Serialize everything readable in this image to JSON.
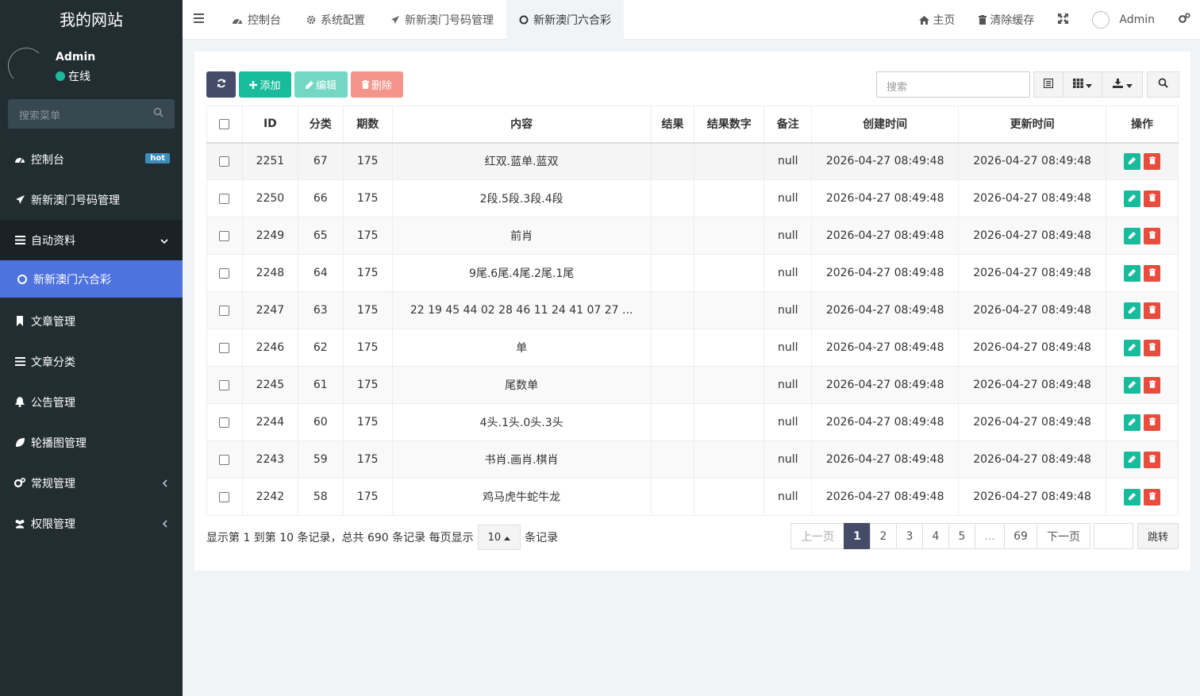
{
  "sidebar": {
    "brand": "我的网站",
    "user": {
      "name": "Admin",
      "status": "在线"
    },
    "search_placeholder": "搜索菜单",
    "menu": [
      {
        "label": "控制台",
        "icon": "dashboard-icon",
        "badge": "hot"
      },
      {
        "label": "新新澳门号码管理",
        "icon": "paper-plane-icon"
      },
      {
        "label": "自动资料",
        "icon": "list-icon",
        "expanded": true
      },
      {
        "label": "新新澳门六合彩",
        "icon": "circle-icon",
        "active": true
      },
      {
        "label": "文章管理",
        "icon": "bookmark-icon"
      },
      {
        "label": "文章分类",
        "icon": "list-icon"
      },
      {
        "label": "公告管理",
        "icon": "bell-icon"
      },
      {
        "label": "轮播图管理",
        "icon": "leaf-icon"
      },
      {
        "label": "常规管理",
        "icon": "cogs-icon"
      },
      {
        "label": "权限管理",
        "icon": "users-icon"
      }
    ]
  },
  "topbar": {
    "tabs": [
      {
        "label": "控制台",
        "icon": "dashboard-icon"
      },
      {
        "label": "系统配置",
        "icon": "gear-icon"
      },
      {
        "label": "新新澳门号码管理",
        "icon": "paper-plane-icon"
      },
      {
        "label": "新新澳门六合彩",
        "icon": "circle-icon",
        "active": true
      }
    ],
    "home_label": "主页",
    "clear_cache_label": "清除缓存",
    "user_name": "Admin"
  },
  "toolbar": {
    "add_label": "添加",
    "edit_label": "编辑",
    "delete_label": "删除",
    "search_placeholder": "搜索"
  },
  "table": {
    "columns": [
      "ID",
      "分类",
      "期数",
      "内容",
      "结果",
      "结果数字",
      "备注",
      "创建时间",
      "更新时间",
      "操作"
    ],
    "rows": [
      {
        "id": "2251",
        "cat": "67",
        "period": "175",
        "content": "红双.蓝单.蓝双",
        "result": "",
        "result_num": "",
        "note": "null",
        "created": "2026-04-27 08:49:48",
        "updated": "2026-04-27 08:49:48"
      },
      {
        "id": "2250",
        "cat": "66",
        "period": "175",
        "content": "2段.5段.3段.4段",
        "result": "",
        "result_num": "",
        "note": "null",
        "created": "2026-04-27 08:49:48",
        "updated": "2026-04-27 08:49:48"
      },
      {
        "id": "2249",
        "cat": "65",
        "period": "175",
        "content": "前肖",
        "result": "",
        "result_num": "",
        "note": "null",
        "created": "2026-04-27 08:49:48",
        "updated": "2026-04-27 08:49:48"
      },
      {
        "id": "2248",
        "cat": "64",
        "period": "175",
        "content": "9尾.6尾.4尾.2尾.1尾",
        "result": "",
        "result_num": "",
        "note": "null",
        "created": "2026-04-27 08:49:48",
        "updated": "2026-04-27 08:49:48"
      },
      {
        "id": "2247",
        "cat": "63",
        "period": "175",
        "content": "22 19 45 44 02 28 46 11 24 41 07 27 ...",
        "result": "",
        "result_num": "",
        "note": "null",
        "created": "2026-04-27 08:49:48",
        "updated": "2026-04-27 08:49:48"
      },
      {
        "id": "2246",
        "cat": "62",
        "period": "175",
        "content": "单",
        "result": "",
        "result_num": "",
        "note": "null",
        "created": "2026-04-27 08:49:48",
        "updated": "2026-04-27 08:49:48"
      },
      {
        "id": "2245",
        "cat": "61",
        "period": "175",
        "content": "尾数单",
        "result": "",
        "result_num": "",
        "note": "null",
        "created": "2026-04-27 08:49:48",
        "updated": "2026-04-27 08:49:48"
      },
      {
        "id": "2244",
        "cat": "60",
        "period": "175",
        "content": "4头.1头.0头.3头",
        "result": "",
        "result_num": "",
        "note": "null",
        "created": "2026-04-27 08:49:48",
        "updated": "2026-04-27 08:49:48"
      },
      {
        "id": "2243",
        "cat": "59",
        "period": "175",
        "content": "书肖.画肖.棋肖",
        "result": "",
        "result_num": "",
        "note": "null",
        "created": "2026-04-27 08:49:48",
        "updated": "2026-04-27 08:49:48"
      },
      {
        "id": "2242",
        "cat": "58",
        "period": "175",
        "content": "鸡马虎牛蛇牛龙",
        "result": "",
        "result_num": "",
        "note": "null",
        "created": "2026-04-27 08:49:48",
        "updated": "2026-04-27 08:49:48"
      }
    ]
  },
  "pagination": {
    "info_prefix": "显示第 1 到第 10 条记录，总共 690 条记录 每页显示",
    "page_size": "10",
    "info_suffix": "条记录",
    "prev": "上一页",
    "pages": [
      "1",
      "2",
      "3",
      "4",
      "5",
      "...",
      "69"
    ],
    "current": "1",
    "next": "下一页",
    "jump_label": "跳转"
  },
  "colors": {
    "sidebar_bg": "#222d32",
    "active_menu": "#4e73df",
    "primary_dark": "#444c69",
    "success": "#18bc9c",
    "danger": "#e74c3c",
    "badge_hot": "#3c8dbc"
  }
}
